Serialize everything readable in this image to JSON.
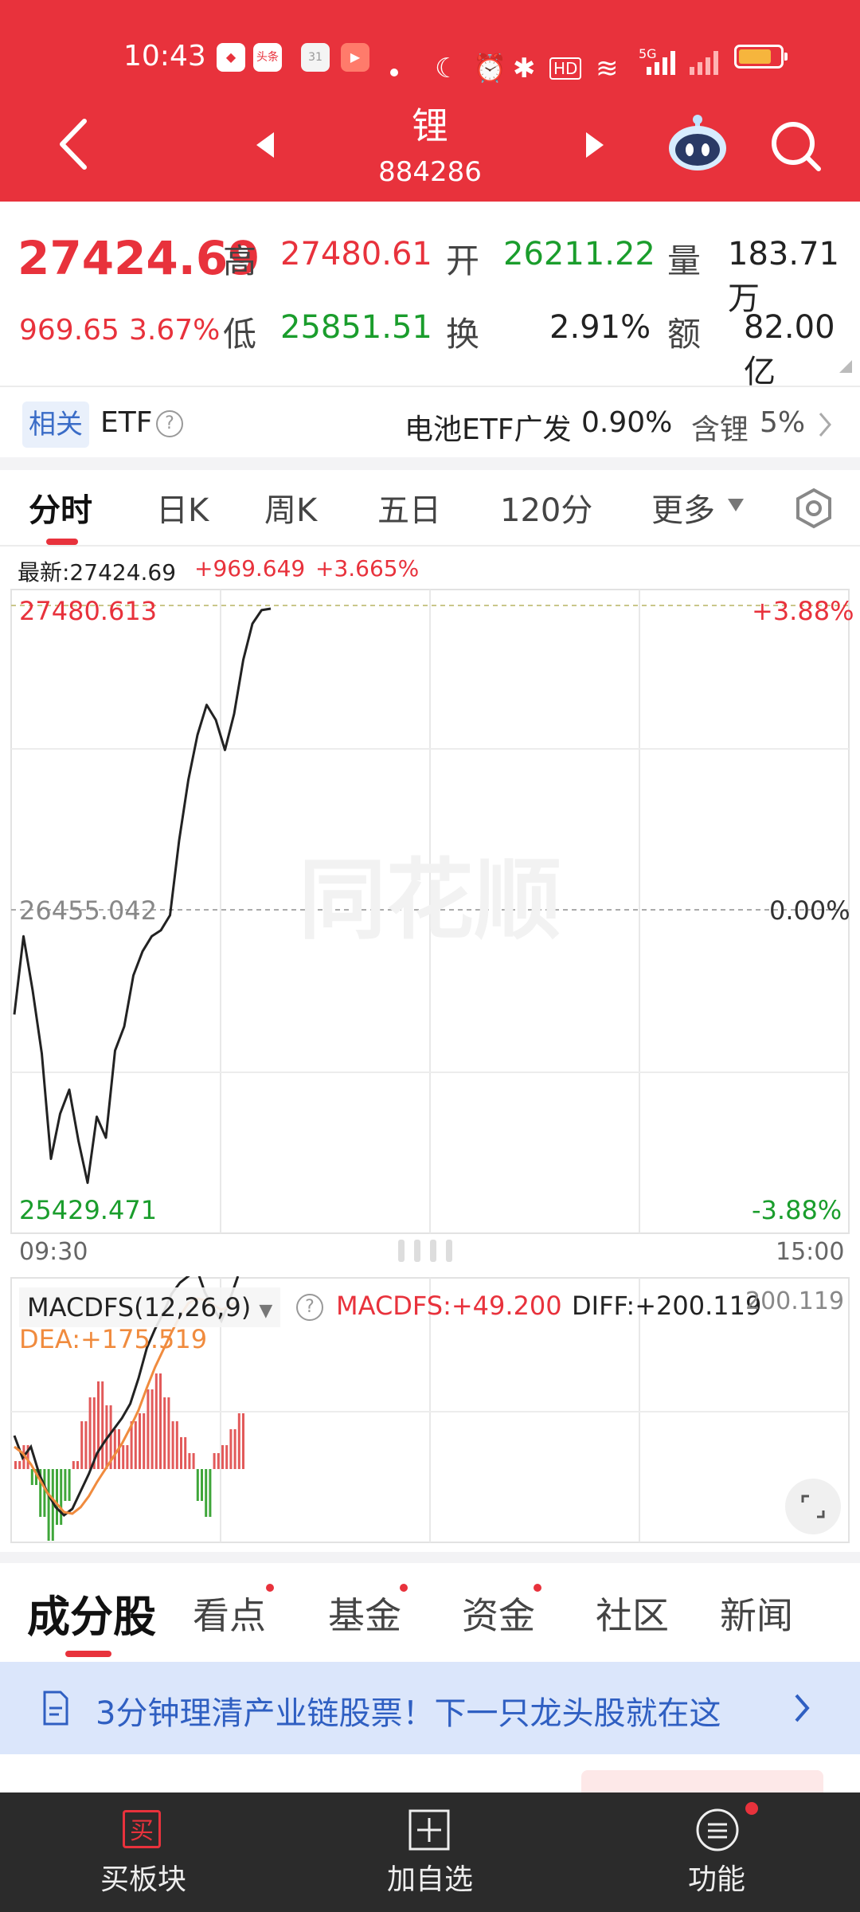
{
  "status_bar": {
    "time": "10:43",
    "app_icons": [
      "头条",
      "31"
    ],
    "network": "5G",
    "battery_percent": 80
  },
  "nav": {
    "title": "锂",
    "code": "884286"
  },
  "quote": {
    "price": "27424.69",
    "change": "969.65",
    "change_pct": "3.67%",
    "high_label": "高",
    "high": "27480.61",
    "low_label": "低",
    "low": "25851.51",
    "open_label": "开",
    "open": "26211.22",
    "turnover_label": "换",
    "turnover": "2.91%",
    "volume_label": "量",
    "volume": "183.71万",
    "amount_label": "额",
    "amount": "82.00亿"
  },
  "etf": {
    "tag": "相关",
    "label": "ETF",
    "name": "电池ETF广发",
    "change": "0.90%",
    "holding_label": "含锂",
    "holding": "5%"
  },
  "tabs": [
    "分时",
    "日K",
    "周K",
    "五日",
    "120分",
    "更多"
  ],
  "intraday": {
    "latest_label": "最新:27424.69",
    "change": "+969.649",
    "change_pct": "+3.665%",
    "max": "27480.613",
    "base": "26455.042",
    "min": "25429.471",
    "max_pct": "+3.88%",
    "base_pct": "0.00%",
    "min_pct": "-3.88%",
    "start_time": "09:30",
    "end_time": "15:00",
    "watermark": "同花顺"
  },
  "macd": {
    "name": "MACDFS(12,26,9)",
    "macdfs": "MACDFS:+49.200",
    "diff": "DIFF:+200.119",
    "dea": "DEA:+175.519",
    "axis_value": "200.119"
  },
  "bottom_tabs": [
    "成分股",
    "看点",
    "基金",
    "资金",
    "社区",
    "新闻"
  ],
  "banner": {
    "text": "3分钟理清产业链股票！下一只龙头股就在这"
  },
  "bottom_nav": {
    "buy": "买板块",
    "buy_icon": "买",
    "watch": "加自选",
    "func": "功能"
  },
  "colors": {
    "brand_red": "#e8323c",
    "up_red": "#e8323c",
    "down_green": "#1a9d2c"
  },
  "chart_data": {
    "type": "line",
    "base": 26455.042,
    "ylim": [
      25429.471,
      27480.613
    ],
    "price_series_sampled": [
      26120,
      26380,
      26200,
      25990,
      25640,
      25790,
      25870,
      25700,
      25560,
      25780,
      25710,
      26000,
      26080,
      26250,
      26330,
      26380,
      26400,
      26450,
      26700,
      26900,
      27050,
      27150,
      27100,
      27000,
      27120,
      27300,
      27420,
      27465,
      27470
    ],
    "macd_hist_sampled": [
      10,
      30,
      -20,
      -60,
      -90,
      -70,
      -40,
      10,
      60,
      90,
      110,
      80,
      50,
      30,
      60,
      70,
      100,
      120,
      90,
      60,
      40,
      20,
      -40,
      -60,
      20,
      30,
      50,
      70
    ]
  }
}
